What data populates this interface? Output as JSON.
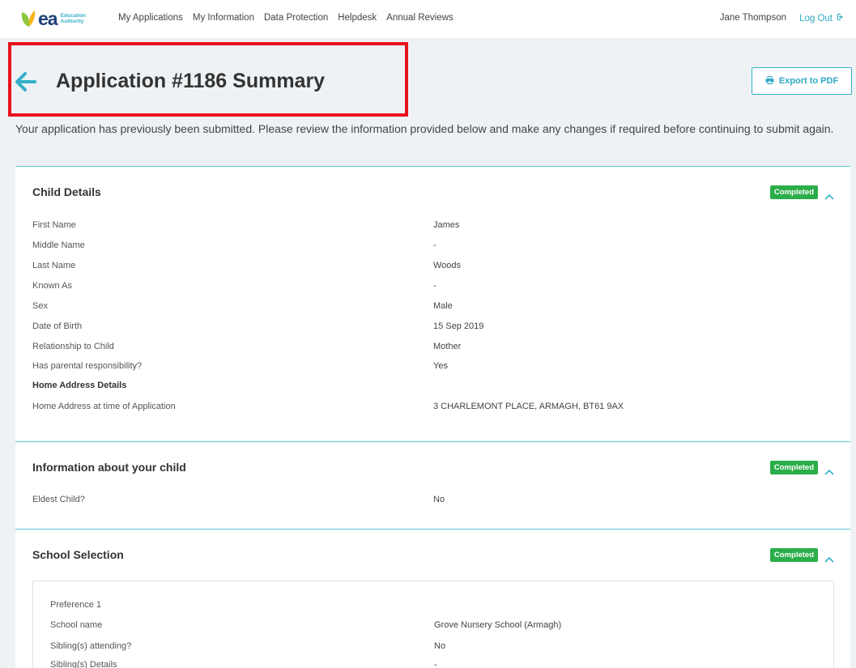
{
  "logo": {
    "text": "ea",
    "sub_line1": "Education",
    "sub_line2": "Authority"
  },
  "nav": {
    "items": [
      "My Applications",
      "My Information",
      "Data Protection",
      "Helpdesk",
      "Annual Reviews"
    ]
  },
  "user": {
    "name": "Jane Thompson",
    "logout": "Log Out"
  },
  "page": {
    "title": "Application #1186 Summary",
    "export_label": "Export to PDF",
    "intro": "Your application has previously been submitted. Please review the information provided below and make any changes if required before continuing to submit again."
  },
  "colors": {
    "accent": "#34b0c8",
    "badge": "#2bae4a",
    "highlight": "#e8121b",
    "brand": "#1e3f7a"
  },
  "sections": {
    "child_details": {
      "title": "Child Details",
      "status": "Completed",
      "rows": [
        {
          "label": "First Name",
          "value": "James"
        },
        {
          "label": "Middle Name",
          "value": "-"
        },
        {
          "label": "Last Name",
          "value": "Woods"
        },
        {
          "label": "Known As",
          "value": "-"
        },
        {
          "label": "Sex",
          "value": "Male"
        },
        {
          "label": "Date of Birth",
          "value": "15 Sep 2019"
        },
        {
          "label": "Relationship to Child",
          "value": "Mother"
        },
        {
          "label": "Has parental responsibility?",
          "value": "Yes"
        },
        {
          "label": "Home Address Details",
          "value": ""
        },
        {
          "label": "Home Address at time of Application",
          "value": "3 CHARLEMONT PLACE, ARMAGH, BT61 9AX"
        }
      ]
    },
    "info_child": {
      "title": "Information about your child",
      "status": "Completed",
      "rows": [
        {
          "label": "Eldest Child?",
          "value": "No"
        }
      ]
    },
    "school_selection": {
      "title": "School Selection",
      "status": "Completed",
      "preference": "Preference 1",
      "rows": [
        {
          "label": "School name",
          "value": "Grove Nursery School (Armagh)"
        },
        {
          "label": "Sibling(s) attending?",
          "value": "No"
        },
        {
          "label": "Sibling(s) Details",
          "value": "-"
        }
      ]
    }
  }
}
